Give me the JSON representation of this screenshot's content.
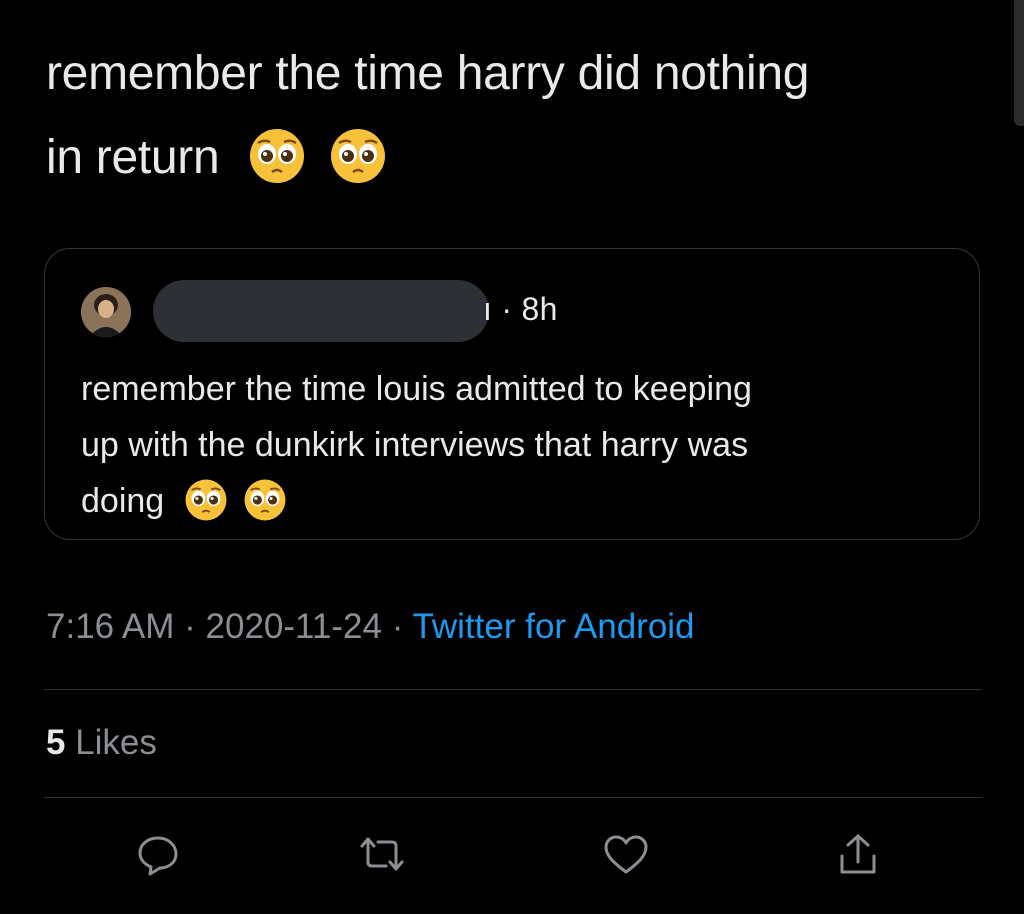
{
  "tweet": {
    "text_line1": "remember the time harry did nothing",
    "text_line2": "in return",
    "emojis": [
      "pleading-face-icon",
      "pleading-face-icon"
    ]
  },
  "quoted_tweet": {
    "author_name_tail": "ı",
    "meta_tail": "ı · 8h",
    "text_line1": "remember the time louis admitted to keeping",
    "text_line2": "up with the dunkirk interviews that harry was",
    "text_line3": "doing",
    "emojis": [
      "pleading-face-icon",
      "pleading-face-icon"
    ]
  },
  "meta": {
    "time": "7:16 AM",
    "separator": " · ",
    "date": "2020-11-24",
    "source": "Twitter for Android"
  },
  "stats": {
    "likes_count": "5",
    "likes_label": " Likes"
  },
  "actions": {
    "reply_icon": "reply-icon",
    "retweet_icon": "retweet-icon",
    "like_icon": "heart-icon",
    "share_icon": "share-icon"
  },
  "colors": {
    "background": "#000000",
    "text": "#e7e9ea",
    "secondary": "#8b8f94",
    "link": "#1d9bf0",
    "border": "#333639"
  }
}
